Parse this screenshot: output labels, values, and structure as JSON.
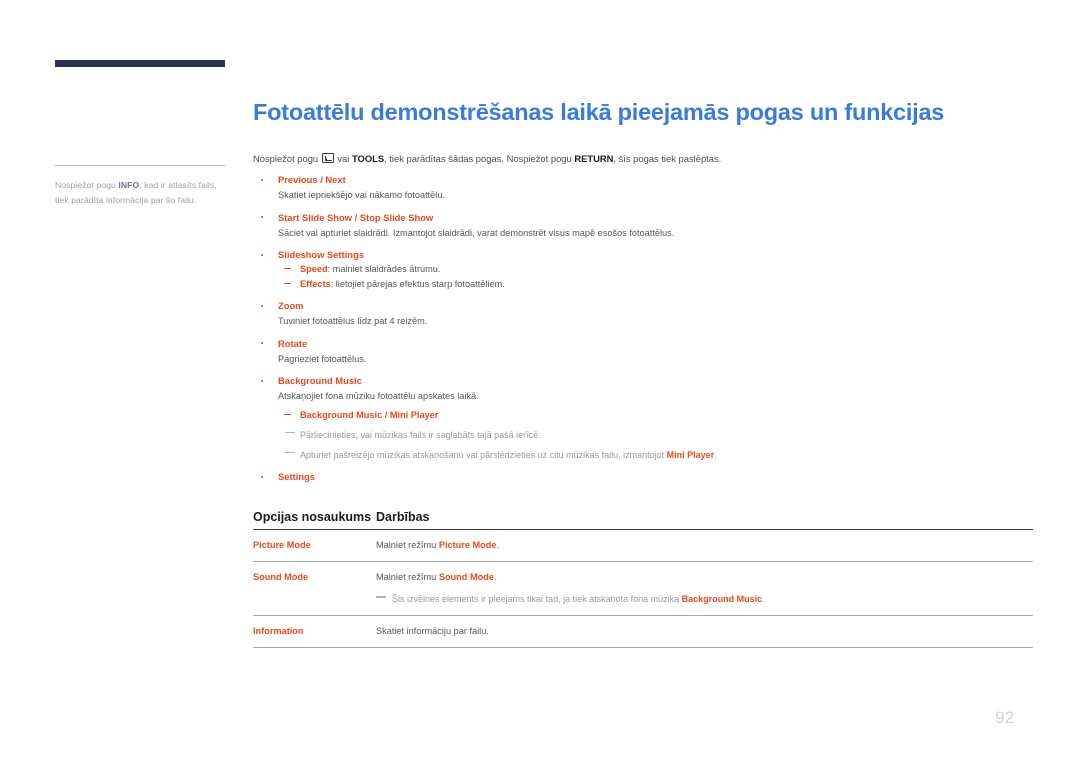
{
  "sidebar": {
    "note_prefix": "Nospiežot pogu ",
    "note_bold": "INFO",
    "note_suffix": ", kad ir atlasīts fails, tiek parādīta informācija par šo failu."
  },
  "page": {
    "title": "Fotoattēlu demonstrēšanas laikā pieejamās pogas un funkcijas",
    "number": "92",
    "title_color": "#3a7ae0",
    "accent_color": "#e8491d",
    "sidebar_bar_color": "#2b3153"
  },
  "intro": {
    "part1": "Nospiežot pogu ",
    "icon": "enter-key-icon",
    "part2": " vai ",
    "bold1": "TOOLS",
    "part3": ", tiek parādītas šādas pogas. Nospiežot pogu ",
    "bold2": "RETURN",
    "part4": ", šīs pogas tiek paslēptas."
  },
  "bullets": [
    {
      "title": "Previous / Next",
      "desc": "Skatiet iepriekšējo vai nākamo fotoattēlu."
    },
    {
      "title": "Start Slide Show / Stop Slide Show",
      "desc": "Sāciet vai apturiet slaidrādi. Izmantojot slaidrādi, varat demonstrēt visus mapē esošos fotoattēlus."
    },
    {
      "title": "Slideshow Settings",
      "subs": [
        {
          "bold": "Speed",
          "text": ": mainiet slaidrādes ātrumu."
        },
        {
          "bold": "Effects",
          "text": ": lietojiet pārejas efektus starp fotoattēliem."
        }
      ]
    },
    {
      "title": "Zoom",
      "desc": "Tuviniet fotoattēlus līdz pat 4 reizēm."
    },
    {
      "title": "Rotate",
      "desc": "Pagrieziet fotoattēlus."
    },
    {
      "title": "Background Music",
      "desc": "Atskaņojiet fona mūziku fotoattēlu apskates laikā.",
      "subs": [
        {
          "bold": "Background Music / Mini Player",
          "text": ""
        }
      ],
      "notes": [
        {
          "text": "Pārliecinieties, vai mūzikas fails ir saglabāts tajā pašā ierīcē.",
          "bold": "",
          "tail": ""
        },
        {
          "text": "Apturiet pašreizējo mūzikas atskaņošanu vai pārslēdzieties uz citu mūzikas failu, izmantojot ",
          "bold": "Mini Player",
          "tail": "."
        }
      ]
    },
    {
      "title": "Settings"
    }
  ],
  "table": {
    "headers": [
      "Opcijas nosaukums",
      "Darbības"
    ],
    "rows": [
      {
        "option": "Picture Mode",
        "action_prefix": "Mainiet režīmu ",
        "action_bold": "Picture Mode",
        "action_suffix": "."
      },
      {
        "option": "Sound Mode",
        "action_prefix": "Mainiet režīmu ",
        "action_bold": "Sound Mode",
        "action_suffix": ".",
        "note_prefix": "Šis izvēlnes elements ir pieejams tikai tad, ja tiek atskaņota fona mūzika ",
        "note_bold": "Background Music",
        "note_suffix": "."
      },
      {
        "option": "Information",
        "action_prefix": "Skatiet informāciju par failu.",
        "action_bold": "",
        "action_suffix": ""
      }
    ]
  }
}
